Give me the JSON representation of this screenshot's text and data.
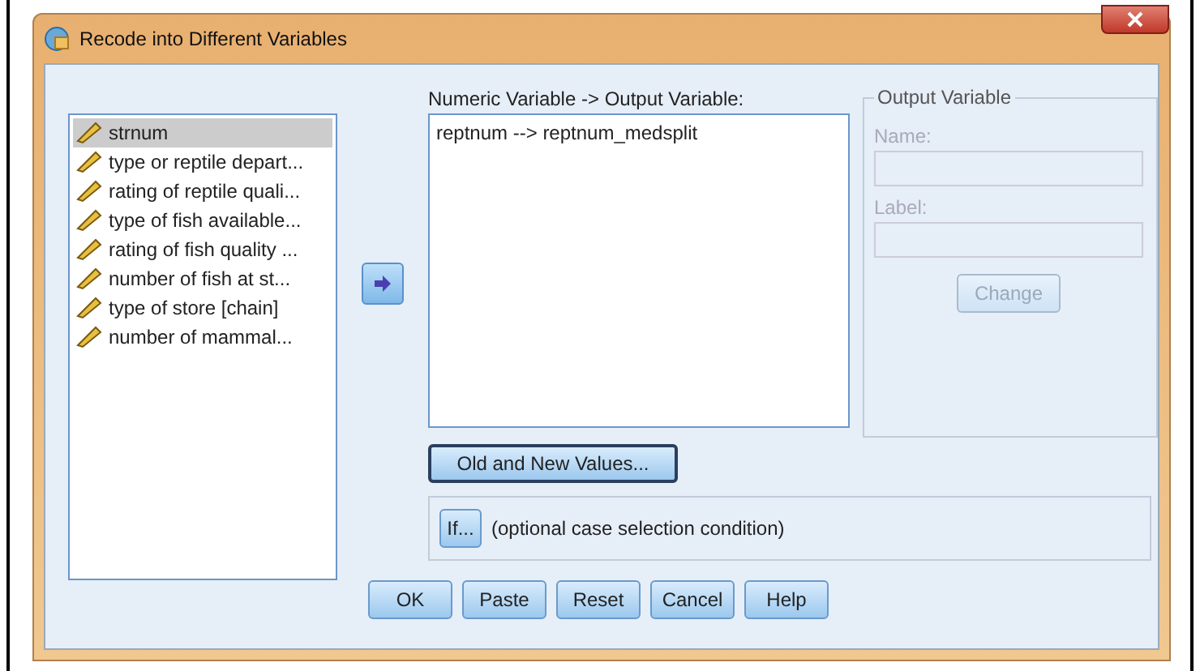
{
  "window": {
    "title": "Recode into Different Variables"
  },
  "variables": [
    {
      "label": "strnum",
      "selected": true
    },
    {
      "label": "type or reptile depart...",
      "selected": false
    },
    {
      "label": "rating of reptile quali...",
      "selected": false
    },
    {
      "label": "type of fish available...",
      "selected": false
    },
    {
      "label": "rating of fish quality ...",
      "selected": false
    },
    {
      "label": "number of fish at st...",
      "selected": false
    },
    {
      "label": "type of store [chain]",
      "selected": false
    },
    {
      "label": "number of mammal...",
      "selected": false
    }
  ],
  "mapping": {
    "label": "Numeric Variable -> Output Variable:",
    "items": [
      "reptnum --> reptnum_medsplit"
    ]
  },
  "output_variable": {
    "title": "Output Variable",
    "name_label": "Name:",
    "label_label": "Label:",
    "change_button": "Change",
    "disabled": true
  },
  "old_new_button": "Old and New Values...",
  "condition": {
    "button": "If...",
    "text": "(optional case selection condition)"
  },
  "buttons": [
    "OK",
    "Paste",
    "Reset",
    "Cancel",
    "Help"
  ]
}
